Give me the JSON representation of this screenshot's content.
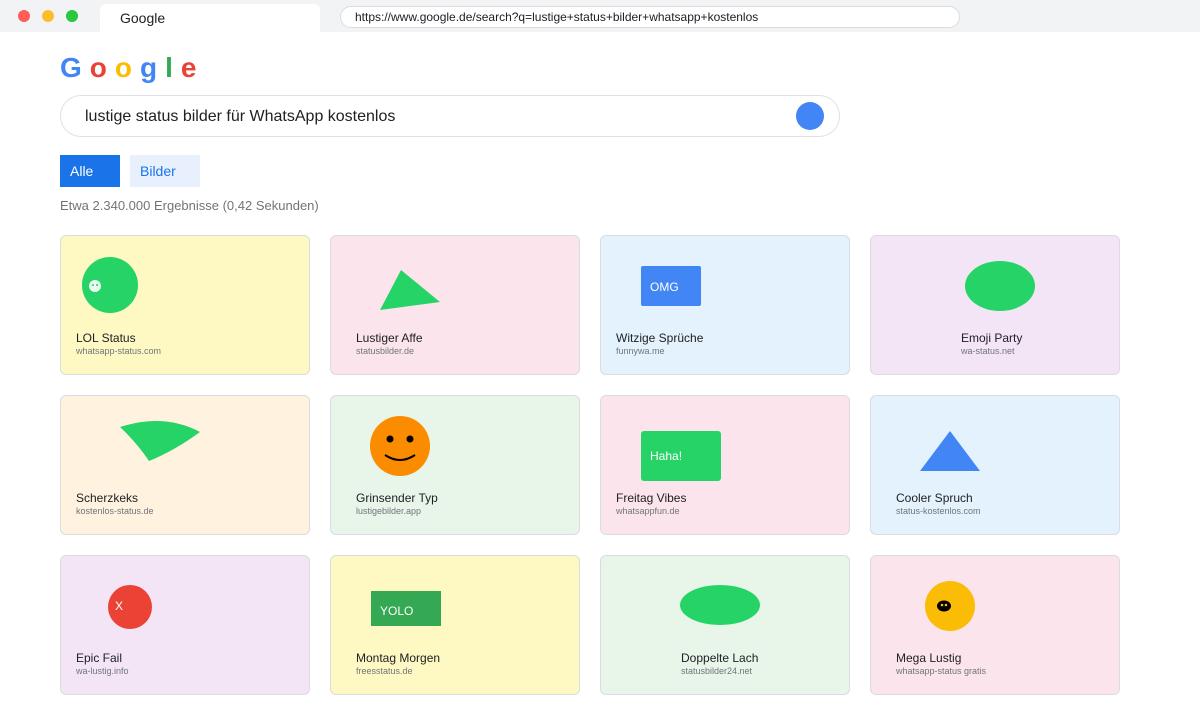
{
  "browser": {
    "tab_title": "Google",
    "url": "https://www.google.de/search?q=lustige+status+bilder+whatsapp+kostenlos"
  },
  "logo": {
    "letters": [
      {
        "char": "G",
        "color": "#4285f4"
      },
      {
        "char": "o",
        "color": "#ea4335"
      },
      {
        "char": "o",
        "color": "#fbbc05"
      },
      {
        "char": "g",
        "color": "#4285f4"
      },
      {
        "char": "l",
        "color": "#34a853"
      },
      {
        "char": "e",
        "color": "#ea4335"
      }
    ]
  },
  "search": {
    "query": "lustige status bilder für WhatsApp kostenlos",
    "button_icon": "search-icon"
  },
  "filters": {
    "all": "Alle",
    "images": "Bilder"
  },
  "results_count": "Etwa 2.340.000 Ergebnisse (0,42 Sekunden)",
  "cards": [
    {
      "title": "LOL Status",
      "source": "whatsapp-status.com",
      "bg": "#fef9c3",
      "shape": "circle-green",
      "icon": "green-circle-sticker"
    },
    {
      "title": "Lustiger Affe",
      "source": "statusbilder.de",
      "bg": "#fce4ec",
      "shape": "triangle-green",
      "icon": "green-triangle-sticker"
    },
    {
      "title": "Witzige Sprüche",
      "source": "funnywa.me",
      "bg": "#e3f2fd",
      "shape": "rect-blue",
      "label": "OMG",
      "icon": "omg-sticker"
    },
    {
      "title": "Emoji Party",
      "source": "wa-status.net",
      "bg": "#f3e5f5",
      "shape": "ellipse-green",
      "icon": "green-ellipse-sticker"
    },
    {
      "title": "Scherzkeks",
      "source": "kostenlos-status.de",
      "bg": "#fff3e0",
      "shape": "leaf-green",
      "icon": "green-leaf-sticker"
    },
    {
      "title": "Grinsender Typ",
      "source": "lustigebilder.app",
      "bg": "#e8f5e9",
      "shape": "smiley",
      "icon": "smiley-icon"
    },
    {
      "title": "Freitag Vibes",
      "source": "whatsappfun.de",
      "bg": "#fce4ec",
      "shape": "rect-green",
      "label": "Haha!",
      "icon": "haha-sticker"
    },
    {
      "title": "Cooler Spruch",
      "source": "status-kostenlos.com",
      "bg": "#e3f2fd",
      "shape": "triangle-blue",
      "icon": "blue-triangle-sticker"
    },
    {
      "title": "Epic Fail",
      "source": "wa-lustig.info",
      "bg": "#f3e5f5",
      "shape": "circle-red",
      "label": "X",
      "icon": "red-x-sticker"
    },
    {
      "title": "Montag Morgen",
      "source": "freesstatus.de",
      "bg": "#fef9c3",
      "shape": "rect-darkgreen",
      "label": "YOLO",
      "icon": "yolo-sticker"
    },
    {
      "title": "Doppelte Lach",
      "source": "statusbilder24.net",
      "bg": "#e8f5e9",
      "shape": "ellipse-green-wide",
      "icon": "green-ellipse-sticker"
    },
    {
      "title": "Mega Lustig",
      "source": "whatsapp-status gratis",
      "bg": "#fce4ec",
      "shape": "circle-yellow",
      "icon": "yellow-face-sticker"
    }
  ]
}
